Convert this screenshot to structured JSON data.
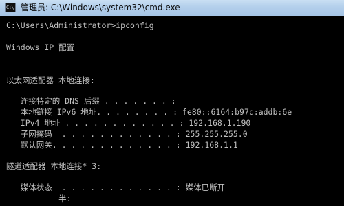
{
  "window": {
    "title": "管理员: C:\\Windows\\system32\\cmd.exe",
    "icon_label": "C:\\",
    "icon_name": "cmd-console-icon"
  },
  "console": {
    "lines": [
      "C:\\Users\\Administrator>ipconfig",
      "",
      "Windows IP 配置",
      "",
      "",
      "以太网适配器 本地连接:",
      "",
      "   连接特定的 DNS 后缀 . . . . . . . :",
      "   本地链接 IPv6 地址. . . . . . . . : fe80::6164:b97c:addb:6e",
      "   IPv4 地址 . . . . . . . . . . . . : 192.168.1.190",
      "   子网掩码  . . . . . . . . . . . . : 255.255.255.0",
      "   默认网关. . . . . . . . . . . . . : 192.168.1.1",
      "",
      "隧道适配器 本地连接* 3:",
      "",
      "   媒体状态  . . . . . . . . . . . . : 媒体已断开",
      "           半:"
    ]
  },
  "colors": {
    "console_background": "#000000",
    "console_text": "#c0c0c0",
    "titlebar": "#b3cfeb"
  }
}
